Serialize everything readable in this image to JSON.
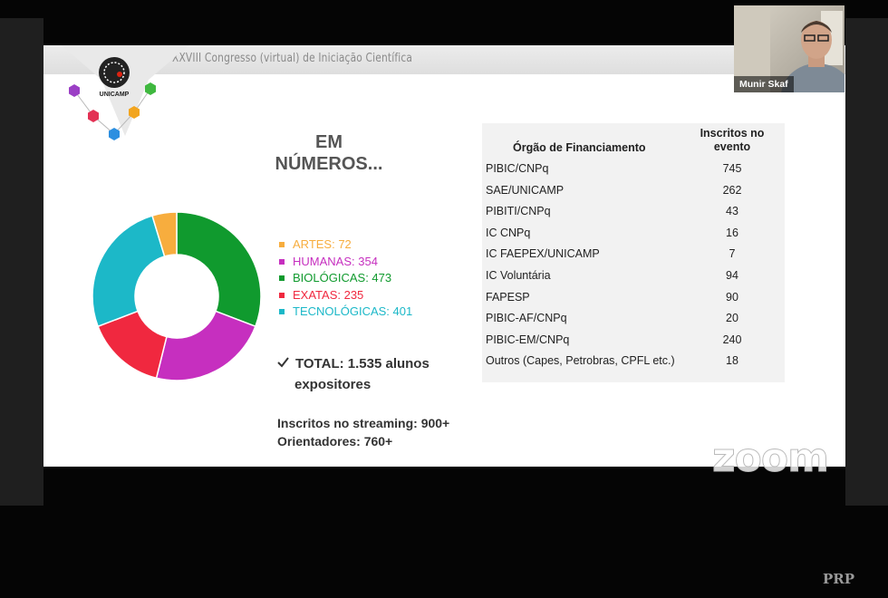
{
  "header": {
    "title": "XXVIII Congresso (virtual) de Iniciação Científica",
    "logo_text": "UNICAMP"
  },
  "slide": {
    "heading_line1": "EM",
    "heading_line2": "NÚMEROS..."
  },
  "chart_data": {
    "type": "pie",
    "donut": true,
    "title": "",
    "categories": [
      "ARTES",
      "HUMANAS",
      "BIOLÓGICAS",
      "EXATAS",
      "TECNOLÓGICAS"
    ],
    "values": [
      72,
      354,
      473,
      235,
      401
    ],
    "colors": [
      "#f7ad3e",
      "#c62fbf",
      "#109a2e",
      "#f0283f",
      "#1cb8c8"
    ],
    "legend_placement": "right",
    "slice_order_clockwise_from_top": [
      "BIOLÓGICAS",
      "HUMANAS",
      "EXATAS",
      "TECNOLÓGICAS",
      "ARTES"
    ]
  },
  "legend": [
    {
      "label": "ARTES: 72",
      "color": "#f7ad3e"
    },
    {
      "label": "HUMANAS: 354",
      "color": "#c62fbf"
    },
    {
      "label": "BIOLÓGICAS: 473",
      "color": "#109a2e"
    },
    {
      "label": "EXATAS: 235",
      "color": "#f0283f"
    },
    {
      "label": "TECNOLÓGICAS: 401",
      "color": "#1cb8c8"
    }
  ],
  "total": {
    "check_icon": "checkmark-icon",
    "line1": "TOTAL: 1.535 alunos",
    "line2": "expositores"
  },
  "stats": {
    "streaming": "Inscritos no streaming: 900+",
    "orientadores": "Orientadores: 760+"
  },
  "table": {
    "col1_header": "Órgão de Financiamento",
    "col2_header_line1": "Inscritos no",
    "col2_header_line2": "evento",
    "rows": [
      {
        "org": "PIBIC/CNPq",
        "count": "745"
      },
      {
        "org": "SAE/UNICAMP",
        "count": "262"
      },
      {
        "org": "PIBITI/CNPq",
        "count": "43"
      },
      {
        "org": "IC CNPq",
        "count": "16"
      },
      {
        "org": "IC FAEPEX/UNICAMP",
        "count": "7"
      },
      {
        "org": "IC Voluntária",
        "count": "94"
      },
      {
        "org": "FAPESP",
        "count": "90"
      },
      {
        "org": "PIBIC-AF/CNPq",
        "count": "20"
      },
      {
        "org": "PIBIC-EM/CNPq",
        "count": "240"
      },
      {
        "org": "Outros (Capes, Petrobras, CPFL etc.)",
        "count": "18"
      }
    ]
  },
  "video": {
    "participant_name": "Munir Skaf"
  },
  "watermarks": {
    "zoom": "zoom",
    "prp": "PRP"
  }
}
